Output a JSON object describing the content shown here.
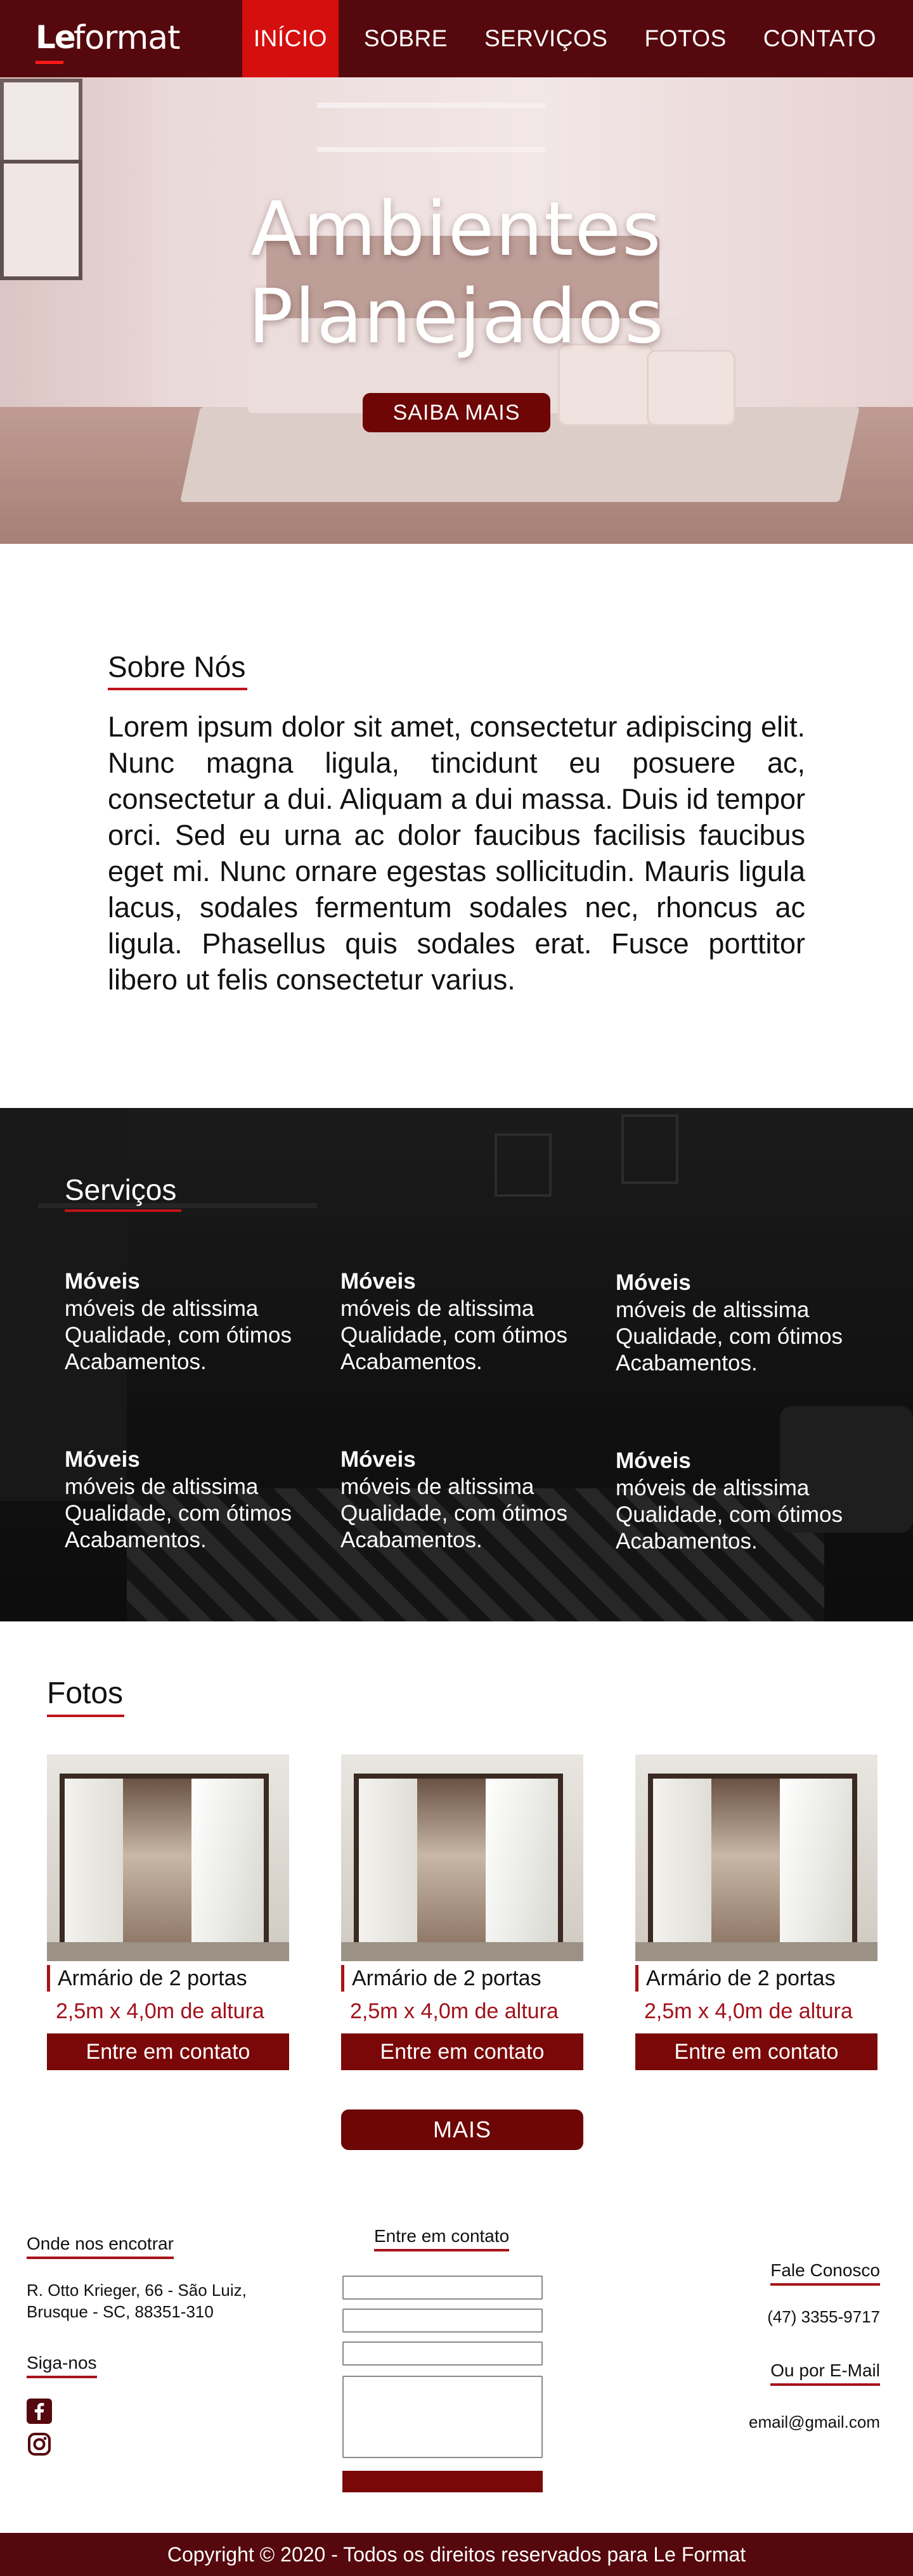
{
  "nav": {
    "logo_part1": "Le",
    "logo_part2": "format",
    "items": [
      {
        "label": "INÍCIO",
        "active": true
      },
      {
        "label": "SOBRE",
        "active": false
      },
      {
        "label": "SERVIÇOS",
        "active": false
      },
      {
        "label": "FOTOS",
        "active": false
      },
      {
        "label": "CONTATO",
        "active": false
      }
    ]
  },
  "hero": {
    "title_line1": "Ambientes",
    "title_line2": "Planejados",
    "button": "SAIBA MAIS"
  },
  "sobre": {
    "title": "Sobre Nós",
    "text": "Lorem ipsum dolor sit amet, consectetur adipiscing elit. Nunc magna ligula, tincidunt eu posuere ac, consectetur a dui. Aliquam a dui massa. Duis id tempor orci. Sed eu urna ac dolor faucibus facilisis faucibus eget mi. Nunc ornare egestas sollicitudin. Mauris ligula lacus, sodales fermentum sodales nec, rhoncus ac ligula. Phasellus quis sodales erat. Fusce porttitor libero ut felis consectetur varius."
  },
  "servicos": {
    "title": "Serviços",
    "items": [
      {
        "title": "Móveis",
        "text": "móveis de altissima Qualidade, com ótimos Acabamentos."
      },
      {
        "title": "Móveis",
        "text": "móveis de altissima Qualidade, com ótimos Acabamentos."
      },
      {
        "title": "Móveis",
        "text": "móveis de altissima Qualidade, com ótimos Acabamentos."
      },
      {
        "title": "Móveis",
        "text": "móveis de altissima Qualidade, com ótimos Acabamentos."
      },
      {
        "title": "Móveis",
        "text": "móveis de altissima Qualidade, com ótimos Acabamentos."
      },
      {
        "title": "Móveis",
        "text": "móveis de altissima Qualidade, com ótimos Acabamentos."
      }
    ]
  },
  "fotos": {
    "title": "Fotos",
    "cards": [
      {
        "name": "Armário de 2 portas",
        "dims": "2,5m x 4,0m de altura",
        "button": "Entre em contato"
      },
      {
        "name": "Armário de 2 portas",
        "dims": "2,5m x 4,0m de altura",
        "button": "Entre em contato"
      },
      {
        "name": "Armário de 2 portas",
        "dims": "2,5m x 4,0m de altura",
        "button": "Entre em contato"
      }
    ],
    "more_button": "MAIS"
  },
  "footer": {
    "location_title": "Onde nos encotrar",
    "address_line1": "R. Otto Krieger, 66 - São Luiz,",
    "address_line2": "Brusque - SC, 88351-310",
    "social_title": "Siga-nos",
    "social_icons": [
      "facebook-icon",
      "instagram-icon"
    ],
    "contact_title": "Entre em contato",
    "phone_title": "Fale Conosco",
    "phone": "(47) 3355-9717",
    "email_title": "Ou por E-Mail",
    "email": "email@gmail.com",
    "copyright": "Copyright © 2020 - Todos os direitos reservados para Le Format"
  },
  "colors": {
    "brand_dark": "#55080d",
    "accent_red": "#d50e0e",
    "button_red": "#7a0808"
  }
}
